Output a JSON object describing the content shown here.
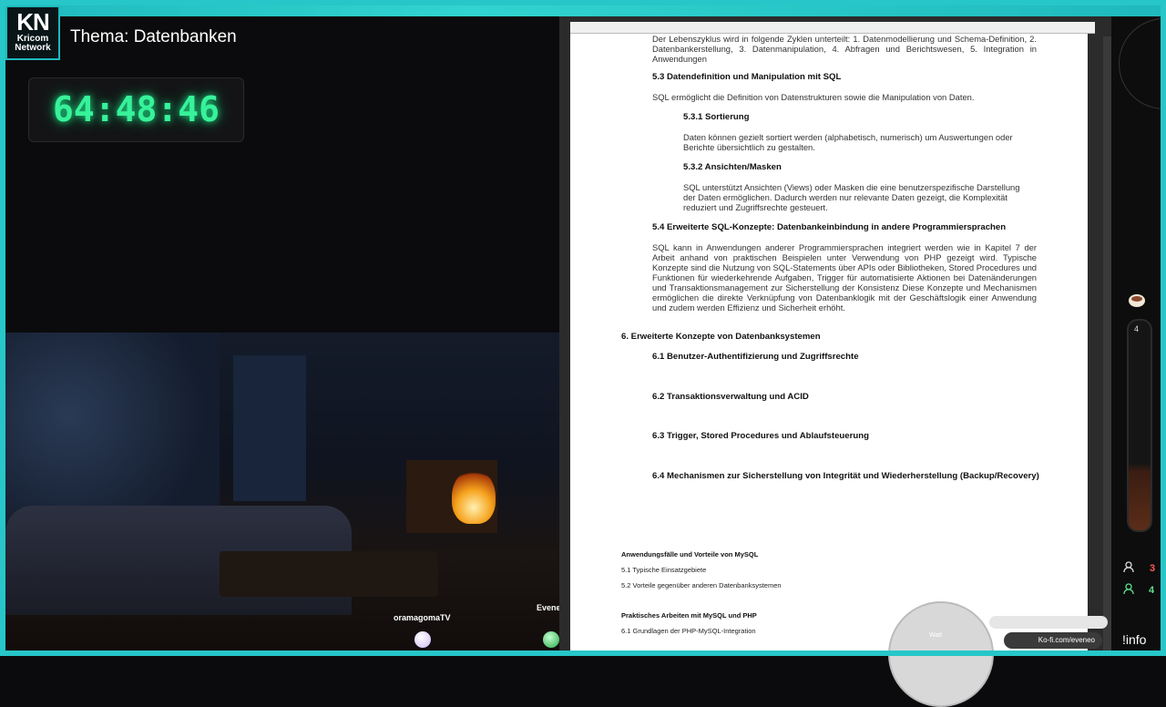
{
  "stream": {
    "logo_main": "KN",
    "logo_sub1": "Kricom",
    "logo_sub2": "Network",
    "title": "Thema: Datenbanken",
    "timer": "64:48:46",
    "viewers": [
      "oramagomaTV",
      "Eveneo"
    ]
  },
  "doc": {
    "intro": "Der Lebenszyklus wird in folgende Zyklen unterteilt: 1. Datenmodellierung und Schema-Definition, 2. Datenbankerstellung, 3. Datenmanipulation, 4. Abfragen und Berichtswesen, 5. Integration in Anwendungen",
    "h53": "5.3 Datendefinition und Manipulation mit SQL",
    "p53": "SQL ermöglicht die Definition von Datenstrukturen sowie die Manipulation von Daten.",
    "h531": "5.3.1 Sortierung",
    "p531": "Daten können gezielt sortiert werden (alphabetisch, numerisch) um Auswertungen oder Berichte übersichtlich zu gestalten.",
    "h532": "5.3.2 Ansichten/Masken",
    "p532": "SQL unterstützt Ansichten (Views) oder Masken die eine benutzerspezifische Darstellung der Daten ermöglichen. Dadurch werden nur relevante Daten gezeigt, die Komplexität reduziert und Zugriffsrechte gesteuert.",
    "h54": "5.4 Erweiterte SQL-Konzepte: Datenbankeinbindung in andere Programmiersprachen",
    "p54": "SQL kann in Anwendungen anderer Programmiersprachen integriert werden wie in Kapitel 7 der Arbeit anhand von praktischen Beispielen unter Verwendung von PHP gezeigt wird. Typische Konzepte sind die Nutzung von SQL-Statements über APIs oder Bibliotheken, Stored Procedures und Funktionen für wiederkehrende Aufgaben, Trigger für automatisierte Aktionen bei Datenänderungen und Transaktionsmanagement zur Sicherstellung der Konsistenz Diese Konzepte und Mechanismen ermöglichen die direkte Verknüpfung von Datenbanklogik mit der Geschäftslogik einer Anwendung und zudem werden Effizienz und Sicherheit erhöht.",
    "h6": "6. Erweiterte Konzepte von Datenbanksystemen",
    "h61": "6.1 Benutzer-Authentifizierung und Zugriffsrechte",
    "h62": "6.2 Transaktionsverwaltung und ACID",
    "h63": "6.3 Trigger, Stored Procedures und Ablaufsteuerung",
    "h64": "6.4 Mechanismen zur Sicherstellung von Integrität und Wiederherstellung (Backup/Recovery)",
    "small1": "Anwendungsfälle und Vorteile von MySQL",
    "small2": "5.1 Typische Einsatzgebiete",
    "small3": "5.2 Vorteile gegenüber anderen Datenbanksystemen",
    "small4": "Praktisches Arbeiten mit MySQL und PHP",
    "small5": "6.1 Grundlagen der PHP-MySQL-Integration"
  },
  "sidebar": {
    "tube_value": "4",
    "count_a": "3",
    "count_b": "4",
    "info": "!info",
    "gauge_label": "Watt",
    "kofi": "Ko-fi.com/eveneo"
  },
  "colors": {
    "accent": "#27c6c8",
    "timer": "#37f29a"
  }
}
